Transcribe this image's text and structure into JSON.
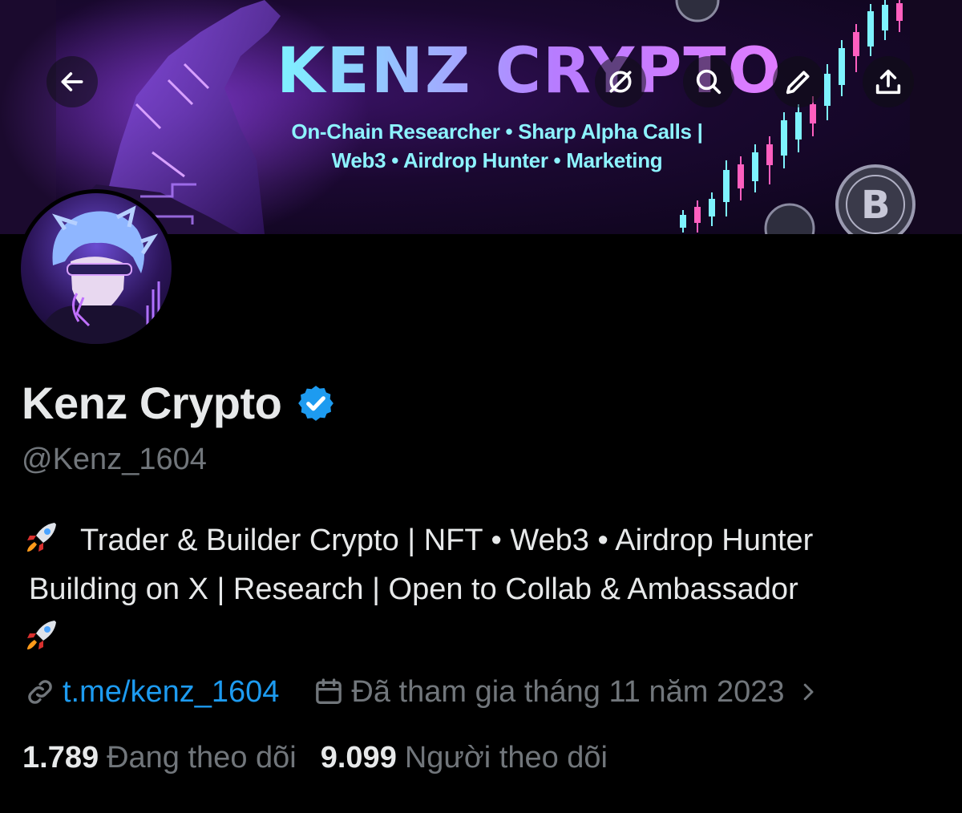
{
  "banner": {
    "title": "KENZ CRYPTO",
    "subtitle_line1": "On-Chain Researcher • Sharp Alpha Calls |",
    "subtitle_line2": "Web3 • Airdrop Hunter • Marketing",
    "coin_letter": "B"
  },
  "header_actions": {
    "back_icon": "arrow-left-icon",
    "hide_icon": "eye-slash-icon",
    "search_icon": "search-icon",
    "edit_icon": "pencil-icon",
    "share_icon": "share-upload-icon"
  },
  "profile": {
    "display_name": "Kenz Crypto",
    "verified": true,
    "verified_color": "#1d9bf0",
    "handle": "@Kenz_1604",
    "bio_line1": "Trader & Builder Crypto | NFT • Web3 • Airdrop Hunter",
    "bio_line2": "Building on X | Research | Open to Collab & Ambassador",
    "bio_emoji": "rocket-emoji"
  },
  "meta": {
    "link": "t.me/kenz_1604",
    "joined": "Đã tham gia tháng 11 năm 2023"
  },
  "stats": {
    "following_count": "1.789",
    "following_label": "Đang theo dõi",
    "followers_count": "9.099",
    "followers_label": "Người theo dõi"
  },
  "colors": {
    "background": "#000000",
    "text_primary": "#e7e9ea",
    "text_secondary": "#71767b",
    "link": "#1d9bf0"
  }
}
